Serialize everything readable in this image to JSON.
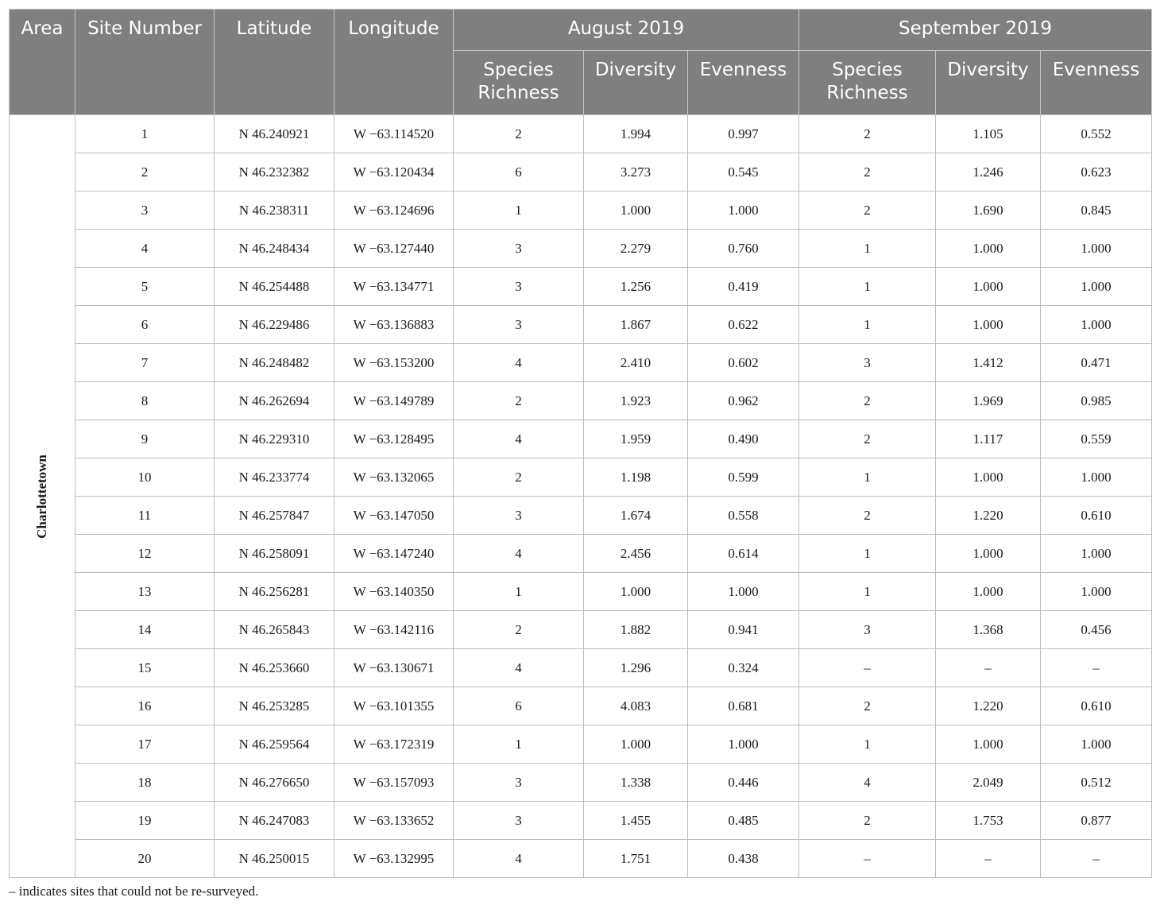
{
  "headers": {
    "area": "Area",
    "site_number": "Site Number",
    "latitude": "Latitude",
    "longitude": "Longitude",
    "group_august": "August 2019",
    "group_september": "September 2019",
    "species_richness": "Species Richness",
    "diversity": "Diversity",
    "evenness": "Evenness"
  },
  "area_name": "Charlottetown",
  "rows": [
    {
      "site": "1",
      "lat": "N 46.240921",
      "lon": "W −63.114520",
      "aug_sr": "2",
      "aug_div": "1.994",
      "aug_even": "0.997",
      "sep_sr": "2",
      "sep_div": "1.105",
      "sep_even": "0.552"
    },
    {
      "site": "2",
      "lat": "N 46.232382",
      "lon": "W −63.120434",
      "aug_sr": "6",
      "aug_div": "3.273",
      "aug_even": "0.545",
      "sep_sr": "2",
      "sep_div": "1.246",
      "sep_even": "0.623"
    },
    {
      "site": "3",
      "lat": "N 46.238311",
      "lon": "W −63.124696",
      "aug_sr": "1",
      "aug_div": "1.000",
      "aug_even": "1.000",
      "sep_sr": "2",
      "sep_div": "1.690",
      "sep_even": "0.845"
    },
    {
      "site": "4",
      "lat": "N 46.248434",
      "lon": "W −63.127440",
      "aug_sr": "3",
      "aug_div": "2.279",
      "aug_even": "0.760",
      "sep_sr": "1",
      "sep_div": "1.000",
      "sep_even": "1.000"
    },
    {
      "site": "5",
      "lat": "N 46.254488",
      "lon": "W −63.134771",
      "aug_sr": "3",
      "aug_div": "1.256",
      "aug_even": "0.419",
      "sep_sr": "1",
      "sep_div": "1.000",
      "sep_even": "1.000"
    },
    {
      "site": "6",
      "lat": "N 46.229486",
      "lon": "W −63.136883",
      "aug_sr": "3",
      "aug_div": "1.867",
      "aug_even": "0.622",
      "sep_sr": "1",
      "sep_div": "1.000",
      "sep_even": "1.000"
    },
    {
      "site": "7",
      "lat": "N 46.248482",
      "lon": "W −63.153200",
      "aug_sr": "4",
      "aug_div": "2.410",
      "aug_even": "0.602",
      "sep_sr": "3",
      "sep_div": "1.412",
      "sep_even": "0.471"
    },
    {
      "site": "8",
      "lat": "N 46.262694",
      "lon": "W −63.149789",
      "aug_sr": "2",
      "aug_div": "1.923",
      "aug_even": "0.962",
      "sep_sr": "2",
      "sep_div": "1.969",
      "sep_even": "0.985"
    },
    {
      "site": "9",
      "lat": "N 46.229310",
      "lon": "W −63.128495",
      "aug_sr": "4",
      "aug_div": "1.959",
      "aug_even": "0.490",
      "sep_sr": "2",
      "sep_div": "1.117",
      "sep_even": "0.559"
    },
    {
      "site": "10",
      "lat": "N 46.233774",
      "lon": "W −63.132065",
      "aug_sr": "2",
      "aug_div": "1.198",
      "aug_even": "0.599",
      "sep_sr": "1",
      "sep_div": "1.000",
      "sep_even": "1.000"
    },
    {
      "site": "11",
      "lat": "N 46.257847",
      "lon": "W −63.147050",
      "aug_sr": "3",
      "aug_div": "1.674",
      "aug_even": "0.558",
      "sep_sr": "2",
      "sep_div": "1.220",
      "sep_even": "0.610"
    },
    {
      "site": "12",
      "lat": "N 46.258091",
      "lon": "W −63.147240",
      "aug_sr": "4",
      "aug_div": "2.456",
      "aug_even": "0.614",
      "sep_sr": "1",
      "sep_div": "1.000",
      "sep_even": "1.000"
    },
    {
      "site": "13",
      "lat": "N 46.256281",
      "lon": "W −63.140350",
      "aug_sr": "1",
      "aug_div": "1.000",
      "aug_even": "1.000",
      "sep_sr": "1",
      "sep_div": "1.000",
      "sep_even": "1.000"
    },
    {
      "site": "14",
      "lat": "N 46.265843",
      "lon": "W −63.142116",
      "aug_sr": "2",
      "aug_div": "1.882",
      "aug_even": "0.941",
      "sep_sr": "3",
      "sep_div": "1.368",
      "sep_even": "0.456"
    },
    {
      "site": "15",
      "lat": "N 46.253660",
      "lon": "W −63.130671",
      "aug_sr": "4",
      "aug_div": "1.296",
      "aug_even": "0.324",
      "sep_sr": "–",
      "sep_div": "–",
      "sep_even": "–"
    },
    {
      "site": "16",
      "lat": "N 46.253285",
      "lon": "W −63.101355",
      "aug_sr": "6",
      "aug_div": "4.083",
      "aug_even": "0.681",
      "sep_sr": "2",
      "sep_div": "1.220",
      "sep_even": "0.610"
    },
    {
      "site": "17",
      "lat": "N 46.259564",
      "lon": "W −63.172319",
      "aug_sr": "1",
      "aug_div": "1.000",
      "aug_even": "1.000",
      "sep_sr": "1",
      "sep_div": "1.000",
      "sep_even": "1.000"
    },
    {
      "site": "18",
      "lat": "N 46.276650",
      "lon": "W −63.157093",
      "aug_sr": "3",
      "aug_div": "1.338",
      "aug_even": "0.446",
      "sep_sr": "4",
      "sep_div": "2.049",
      "sep_even": "0.512"
    },
    {
      "site": "19",
      "lat": "N 46.247083",
      "lon": "W −63.133652",
      "aug_sr": "3",
      "aug_div": "1.455",
      "aug_even": "0.485",
      "sep_sr": "2",
      "sep_div": "1.753",
      "sep_even": "0.877"
    },
    {
      "site": "20",
      "lat": "N 46.250015",
      "lon": "W −63.132995",
      "aug_sr": "4",
      "aug_div": "1.751",
      "aug_even": "0.438",
      "sep_sr": "–",
      "sep_div": "–",
      "sep_even": "–"
    }
  ],
  "footnote": "– indicates sites that could not be re-surveyed."
}
